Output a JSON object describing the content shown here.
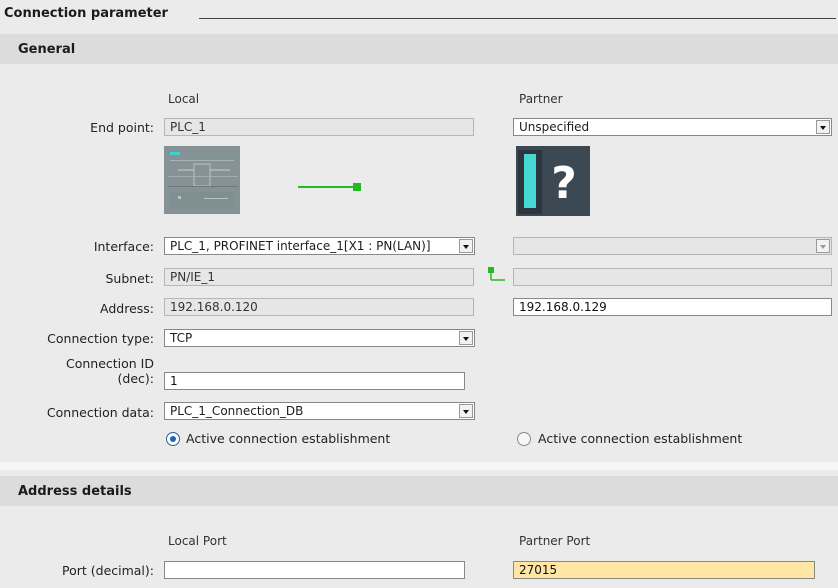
{
  "panel": {
    "title": "Connection parameter"
  },
  "general": {
    "heading": "General",
    "local_col": "Local",
    "partner_col": "Partner",
    "labels": {
      "end_point": "End point:",
      "interface": "Interface:",
      "subnet": "Subnet:",
      "address": "Address:",
      "connection_type": "Connection type:",
      "connection_id_line1": "Connection ID",
      "connection_id_line2": "(dec):",
      "connection_data": "Connection data:"
    },
    "local": {
      "end_point": "PLC_1",
      "interface": "PLC_1, PROFINET interface_1[X1 : PN(LAN)]",
      "subnet": "PN/IE_1",
      "address": "192.168.0.120",
      "connection_type": "TCP",
      "connection_id": "1",
      "connection_data": "PLC_1_Connection_DB",
      "active_label": "Active connection establishment",
      "active_checked": true
    },
    "partner": {
      "end_point": "Unspecified",
      "interface": "",
      "subnet": "",
      "address": "192.168.0.129",
      "active_label": "Active connection establishment",
      "active_checked": false
    },
    "icons": {
      "local_device": "plc-device-icon",
      "link": "network-link-icon",
      "partner_device": "unknown-device-icon",
      "subnet": "subnet-link-icon"
    },
    "colors": {
      "link_green": "#22bb22",
      "partner_icon_teal": "#39c6c4",
      "partner_icon_dark": "#3a4650"
    }
  },
  "address_details": {
    "heading": "Address details",
    "local_col": "Local Port",
    "partner_col": "Partner Port",
    "port_label": "Port (decimal):",
    "local_port": "",
    "partner_port": "27015"
  }
}
